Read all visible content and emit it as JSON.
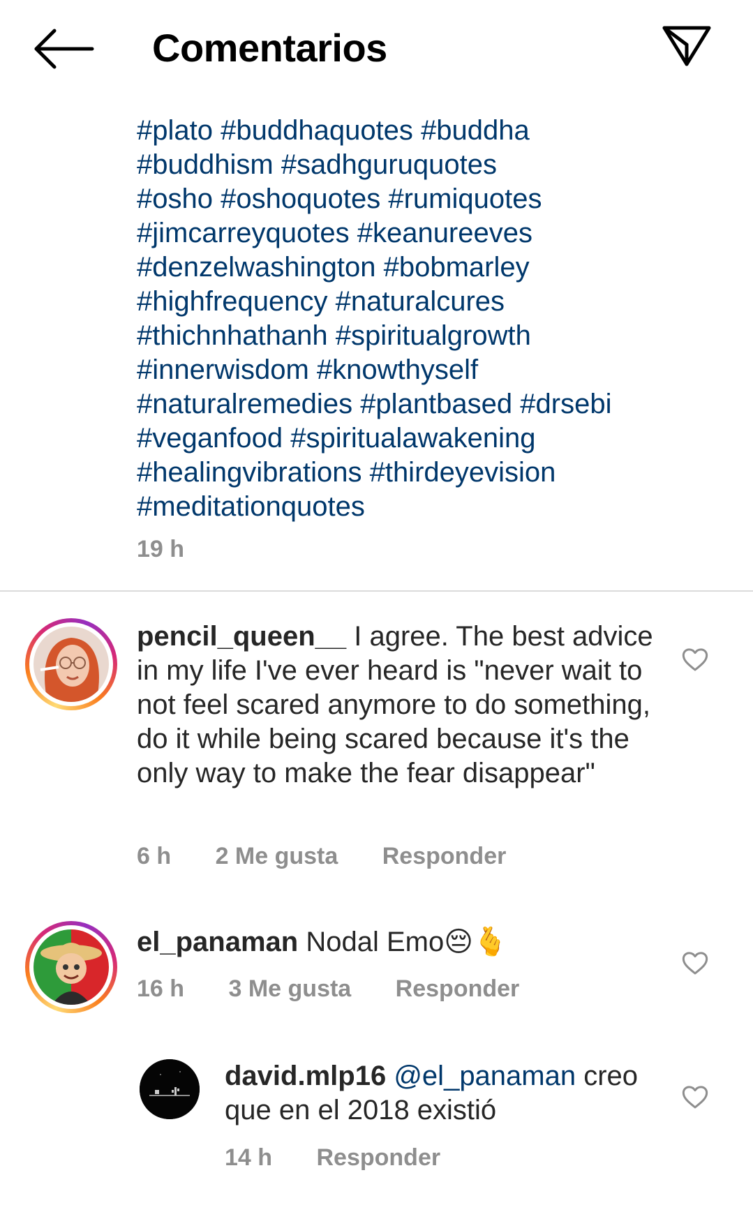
{
  "header": {
    "title": "Comentarios"
  },
  "caption": {
    "hashtags": [
      "#plato",
      "#buddhaquotes",
      "#buddha",
      "#buddhism",
      "#sadhguruquotes",
      "#osho",
      "#oshoquotes",
      "#rumiquotes",
      "#jimcarreyquotes",
      "#keanureeves",
      "#denzelwashington",
      "#bobmarley",
      "#highfrequency",
      "#naturalcures",
      "#thichnhathanh",
      "#spiritualgrowth",
      "#innerwisdom",
      "#knowthyself",
      "#naturalremedies",
      "#plantbased",
      "#drsebi",
      "#veganfood",
      "#spiritualawakening",
      "#healingvibrations",
      "#thirdeyevision",
      "#meditationquotes"
    ],
    "time": "19 h"
  },
  "comments": [
    {
      "username": "pencil_queen__",
      "text": "I agree. The best advice in my life I've ever heard is \"never wait to not feel scared anymore to do something, do it while being scared because it's the only way to make the fear disappear\"",
      "time": "6 h",
      "likes": "2 Me gusta",
      "reply": "Responder"
    },
    {
      "username": "el_panaman",
      "text": "Nodal Emo😔🫰",
      "time": "16 h",
      "likes": "3 Me gusta",
      "reply": "Responder"
    },
    {
      "username": "david.mlp16",
      "mention": "@el_panaman",
      "text": "creo que en el 2018 existió",
      "time": "14 h",
      "reply": "Responder"
    }
  ],
  "colors": {
    "link": "#00376b",
    "muted": "#8e8e8e",
    "text": "#262626",
    "divider": "#dbdbdb"
  },
  "icons": {
    "back": "arrow-left-icon",
    "share": "paper-plane-icon",
    "like": "heart-outline-icon"
  }
}
